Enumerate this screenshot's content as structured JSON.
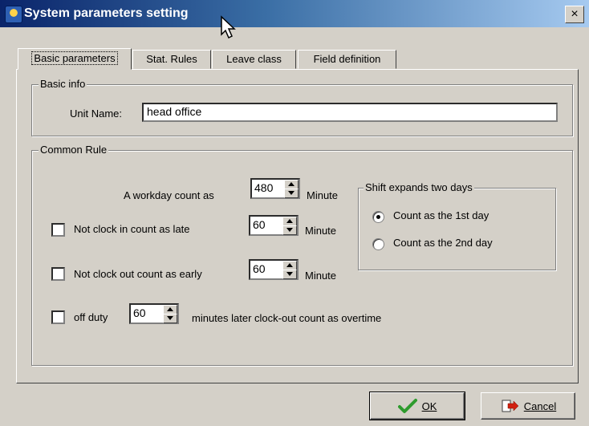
{
  "window": {
    "title": "System parameters setting",
    "close_label": "×"
  },
  "tabs": [
    {
      "label": "Basic parameters",
      "active": true
    },
    {
      "label": "Stat. Rules",
      "active": false
    },
    {
      "label": "Leave class",
      "active": false
    },
    {
      "label": "Field definition",
      "active": false
    }
  ],
  "basic_info": {
    "group_label": "Basic info",
    "unit_name_label": "Unit Name:",
    "unit_name_value": "head office"
  },
  "common_rule": {
    "group_label": "Common Rule",
    "workday": {
      "label": "A workday count as",
      "value": "480",
      "unit": "Minute"
    },
    "late": {
      "label": "Not clock in count as late",
      "checked": false,
      "value": "60",
      "unit": "Minute"
    },
    "early": {
      "label": "Not clock out count as early",
      "checked": false,
      "value": "60",
      "unit": "Minute"
    },
    "overtime": {
      "label": "off duty",
      "checked": false,
      "value": "60",
      "suffix": "minutes later clock-out count as overtime"
    },
    "shift": {
      "group_label": "Shift expands two days",
      "options": [
        {
          "label": "Count as the 1st day",
          "checked": true
        },
        {
          "label": "Count as the 2nd day",
          "checked": false
        }
      ]
    }
  },
  "buttons": {
    "ok_label": "OK",
    "cancel_label": "Cancel"
  },
  "icons": {
    "app": "app-icon",
    "close": "close-icon",
    "ok": "checkmark-icon",
    "cancel": "cancel-icon",
    "cursor": "mouse-cursor-icon"
  },
  "colors": {
    "titlebar_start": "#0a246a",
    "titlebar_end": "#a6caf0",
    "ok_icon": "#2e9b2e",
    "cancel_icon": "#d02010"
  }
}
